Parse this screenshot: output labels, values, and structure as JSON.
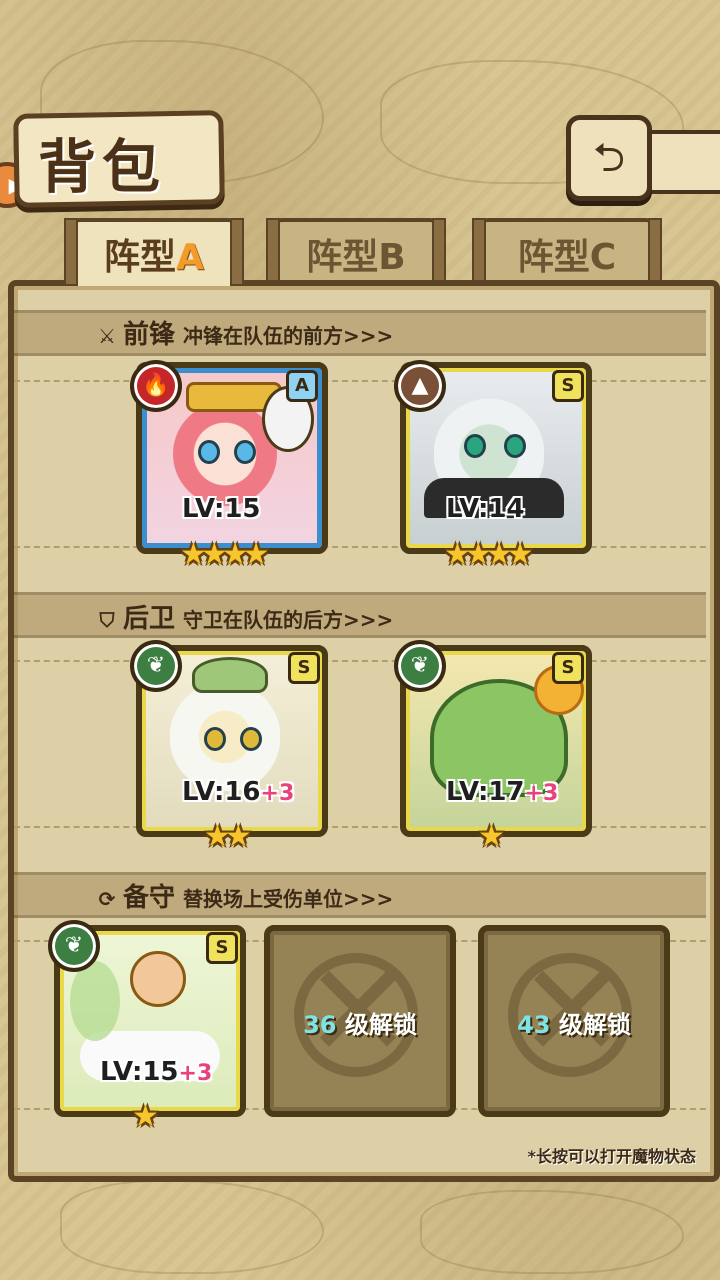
{
  "header": {
    "title": "背包"
  },
  "tabs": [
    {
      "prefix": "阵型",
      "suffix": "A",
      "active": true
    },
    {
      "prefix": "阵型",
      "suffix": "B",
      "active": false
    },
    {
      "prefix": "阵型",
      "suffix": "C",
      "active": false
    }
  ],
  "sections": {
    "front": {
      "title": "前锋",
      "subtitle": "冲锋在队伍的前方>>>",
      "icon": "sword-icon"
    },
    "back": {
      "title": "后卫",
      "subtitle": "守卫在队伍的后方>>>",
      "icon": "shield-icon"
    },
    "reserve": {
      "title": "备守",
      "subtitle": "替换场上受伤单位>>>",
      "icon": "swap-icon"
    }
  },
  "cards": [
    {
      "element": "fire-icon",
      "rank": "A",
      "level": "LV:15",
      "bonus": "",
      "stars": "★★★★"
    },
    {
      "element": "earth-icon",
      "rank": "S",
      "level": "LV:14",
      "bonus": "",
      "stars": "★★★★"
    },
    {
      "element": "leaf-icon",
      "rank": "S",
      "level": "LV:16",
      "bonus": "+3",
      "stars": "★★"
    },
    {
      "element": "leaf-icon",
      "rank": "S",
      "level": "LV:17",
      "bonus": "+3",
      "stars": "★"
    },
    {
      "element": "leaf-icon",
      "rank": "S",
      "level": "LV:15",
      "bonus": "+3",
      "stars": "★"
    }
  ],
  "locked_slots": [
    {
      "level": "36",
      "text": "级解锁"
    },
    {
      "level": "43",
      "text": "级解锁"
    }
  ],
  "footer_note": "*长按可以打开魔物状态",
  "colors": {
    "accent": "#f29a2a",
    "rank_gold": "#f0e25d",
    "plus": "#e8417c",
    "lock_level": "#7fe3e6"
  }
}
